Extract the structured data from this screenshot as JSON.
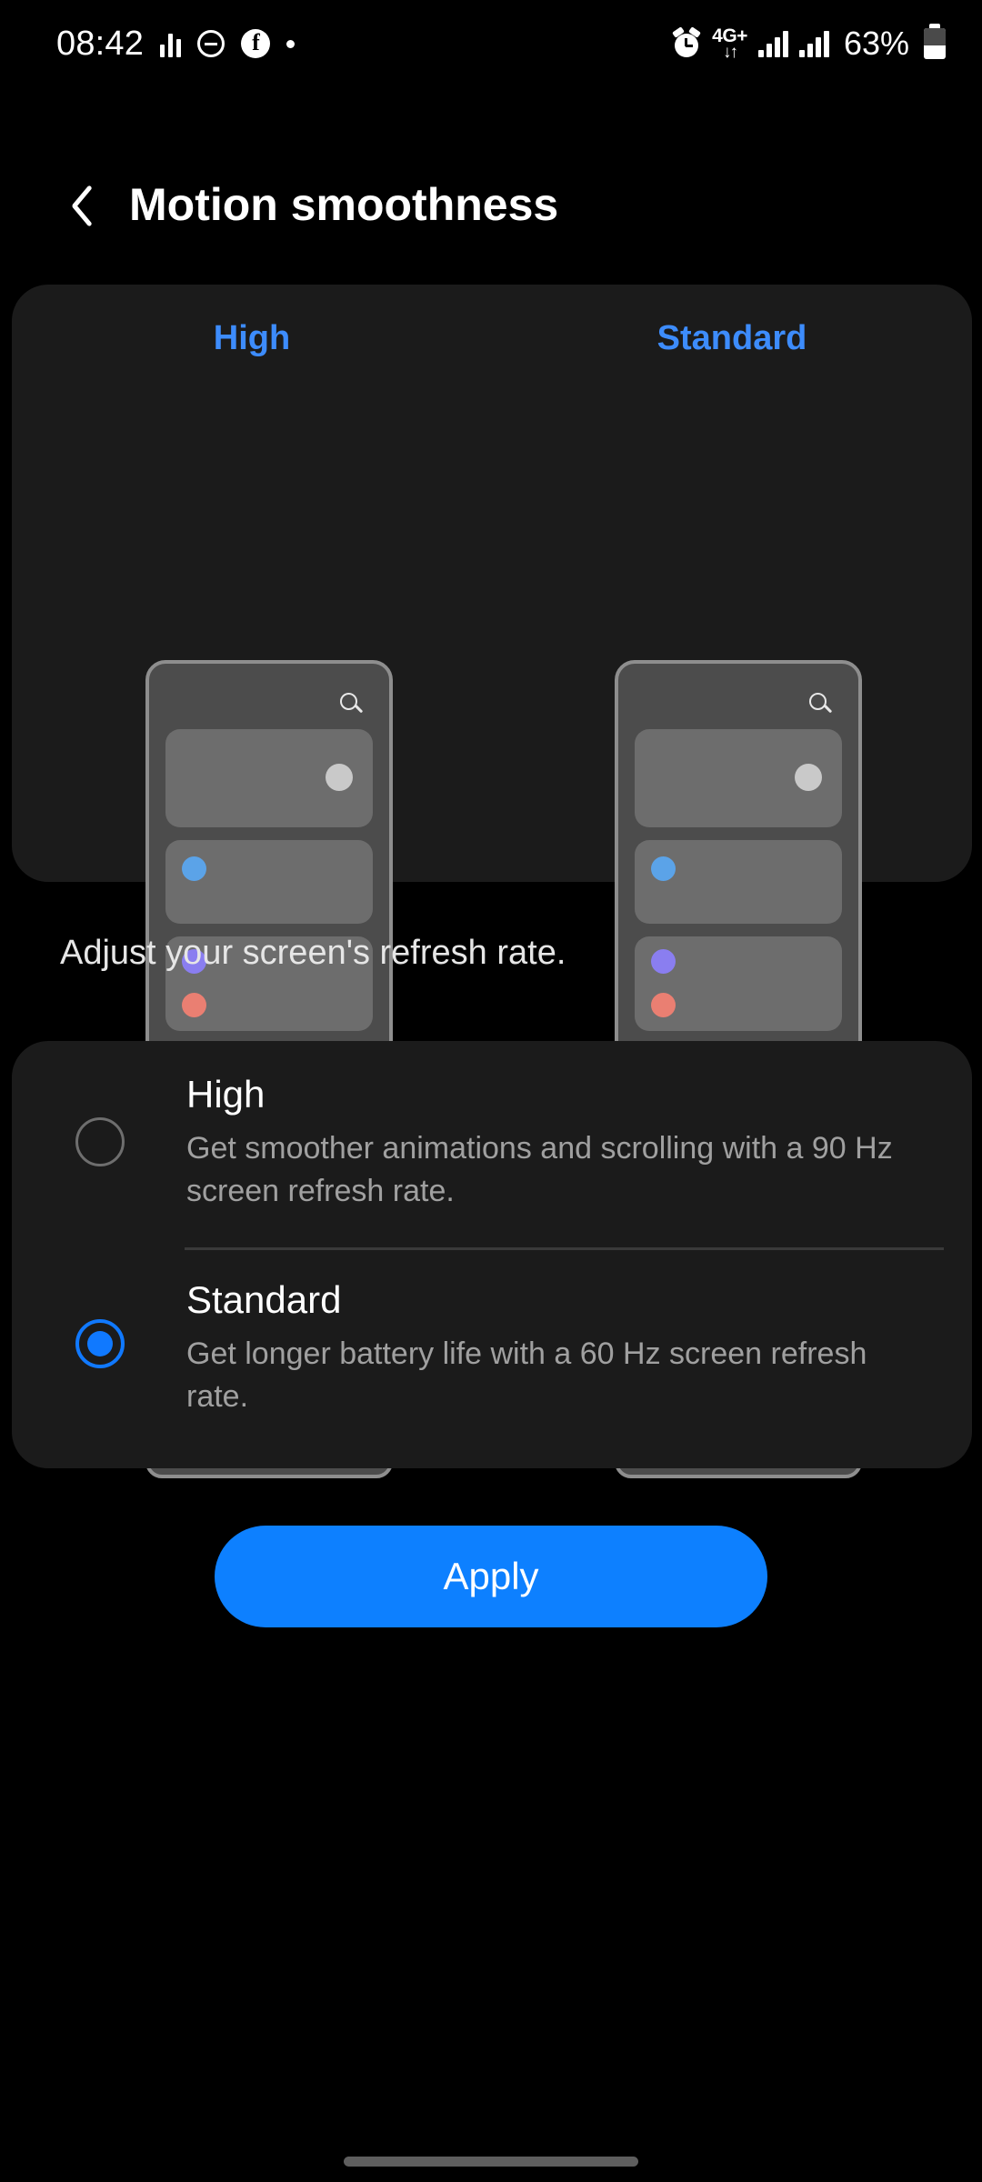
{
  "status_bar": {
    "time": "08:42",
    "left_icons": [
      "equalizer-icon",
      "do-not-disturb-icon",
      "facebook-icon",
      "dot-icon"
    ],
    "facebook_glyph": "f",
    "alarm_icon": "alarm-icon",
    "network_type": "4G+",
    "network_arrows": "↓↑",
    "signal_icons": [
      "signal-bars-sim1",
      "signal-bars-sim2"
    ],
    "battery_percent": "63%",
    "battery_icon": "battery-icon"
  },
  "header": {
    "back_icon": "chevron-left-icon",
    "title": "Motion smoothness"
  },
  "preview": {
    "columns": [
      {
        "label": "High",
        "label_color": "#3d8cfc",
        "search_icon": "search-icon"
      },
      {
        "label": "Standard",
        "label_color": "#3d8cfc",
        "search_icon": "search-icon"
      }
    ],
    "dot_colors": {
      "white": "#c9c9c9",
      "blue": "#5ba3e8",
      "purple": "#8a7ef0",
      "salmon": "#ea7f72",
      "green": "#9bc818",
      "pink": "#eb85b4"
    }
  },
  "description": "Adjust your screen's refresh rate.",
  "options": [
    {
      "id": "high",
      "title": "High",
      "description": "Get smoother animations and scrolling with a 90 Hz screen refresh rate.",
      "selected": false
    },
    {
      "id": "standard",
      "title": "Standard",
      "description": "Get longer battery life with a 60 Hz screen refresh rate.",
      "selected": true
    }
  ],
  "apply_button": {
    "label": "Apply",
    "color": "#0d80ff"
  },
  "nav": {
    "gesture_bar": "gesture-bar"
  }
}
